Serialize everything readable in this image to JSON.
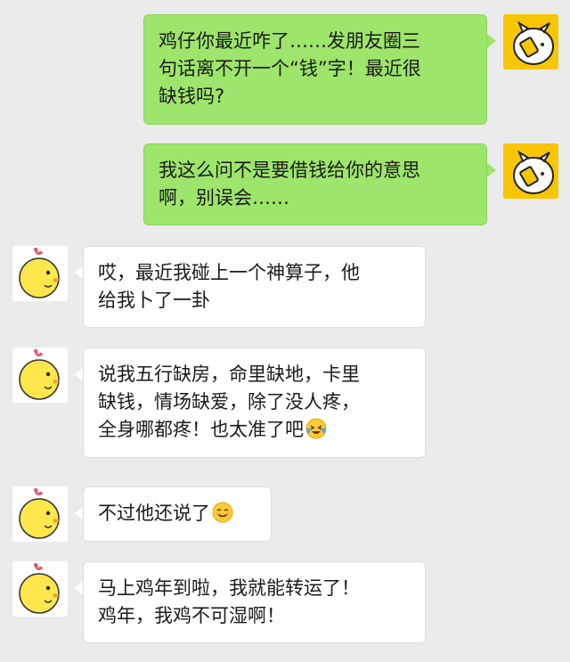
{
  "messages": [
    {
      "side": "out",
      "lines": [
        "鸡仔你最近咋了……发朋友圈三",
        "句话离不开一个“钱”字！最近很",
        "缺钱吗?"
      ]
    },
    {
      "side": "out",
      "lines": [
        "我这么问不是要借钱给你的意思",
        "啊，别误会……"
      ]
    },
    {
      "side": "in",
      "lines": [
        "哎，最近我碰上一个神算子，他",
        "给我卜了一卦"
      ]
    },
    {
      "side": "in",
      "lines": [
        "说我五行缺房，命里缺地，卡里",
        "缺钱，情场缺爱，除了没人疼，",
        "全身哪都疼！也太准了吧"
      ],
      "emoji": "laughing-tears-emoji"
    },
    {
      "side": "in",
      "lines": [
        "不过他还说了"
      ],
      "emoji": "smiling-emoji"
    },
    {
      "side": "in",
      "lines": [
        "马上鸡年到啦，我就能转运了！",
        "鸡年，我鸡不可湿啊！"
      ]
    }
  ],
  "avatars": {
    "me": {
      "icon": "yellow-cartoon-avatar-icon",
      "bg": "#f7c600"
    },
    "friend": {
      "icon": "yellow-chick-avatar-icon",
      "bg": "#ffffff"
    }
  },
  "colors": {
    "background": "#ebebeb",
    "outgoing_bubble": "#9ee56b",
    "incoming_bubble": "#ffffff"
  }
}
